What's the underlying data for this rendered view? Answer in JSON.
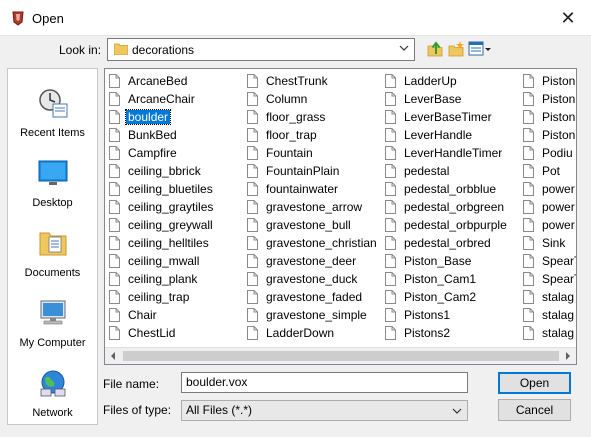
{
  "window": {
    "title": "Open",
    "close_glyph": "✕"
  },
  "look_in": {
    "label": "Look in:",
    "value": "decorations"
  },
  "places": [
    {
      "label": "Recent Items",
      "icon": "recent-items-icon"
    },
    {
      "label": "Desktop",
      "icon": "desktop-icon"
    },
    {
      "label": "Documents",
      "icon": "documents-icon"
    },
    {
      "label": "My Computer",
      "icon": "computer-icon"
    },
    {
      "label": "Network",
      "icon": "network-icon"
    }
  ],
  "files": [
    [
      "ArcaneBed",
      "ArcaneChair",
      "boulder",
      "BunkBed",
      "Campfire",
      "ceiling_bbrick",
      "ceiling_bluetiles",
      "ceiling_graytiles",
      "ceiling_greywall",
      "ceiling_helltiles",
      "ceiling_mwall",
      "ceiling_plank",
      "ceiling_trap",
      "Chair",
      "ChestLid"
    ],
    [
      "ChestTrunk",
      "Column",
      "floor_grass",
      "floor_trap",
      "Fountain",
      "FountainPlain",
      "fountainwater",
      "gravestone_arrow",
      "gravestone_bull",
      "gravestone_christian",
      "gravestone_deer",
      "gravestone_duck",
      "gravestone_faded",
      "gravestone_simple",
      "LadderDown"
    ],
    [
      "LadderUp",
      "LeverBase",
      "LeverBaseTimer",
      "LeverHandle",
      "LeverHandleTimer",
      "pedestal",
      "pedestal_orbblue",
      "pedestal_orbgreen",
      "pedestal_orbpurple",
      "pedestal_orbred",
      "Piston_Base",
      "Piston_Cam1",
      "Piston_Cam2",
      "Pistons1",
      "Pistons2"
    ],
    [
      "Piston",
      "Piston",
      "Piston",
      "Piston",
      "Podiu",
      "Pot",
      "power",
      "power",
      "power",
      "Sink",
      "SpearT",
      "SpearT",
      "stalag",
      "stalag",
      "stalag"
    ]
  ],
  "selected_file": "boulder",
  "file_name": {
    "label": "File name:",
    "value": "boulder.vox"
  },
  "file_type": {
    "label": "Files of type:",
    "value": "All Files (*.*)"
  },
  "buttons": {
    "open": "Open",
    "cancel": "Cancel"
  },
  "colors": {
    "selection": "#0078d7",
    "window_bg": "#f0f0f0"
  }
}
